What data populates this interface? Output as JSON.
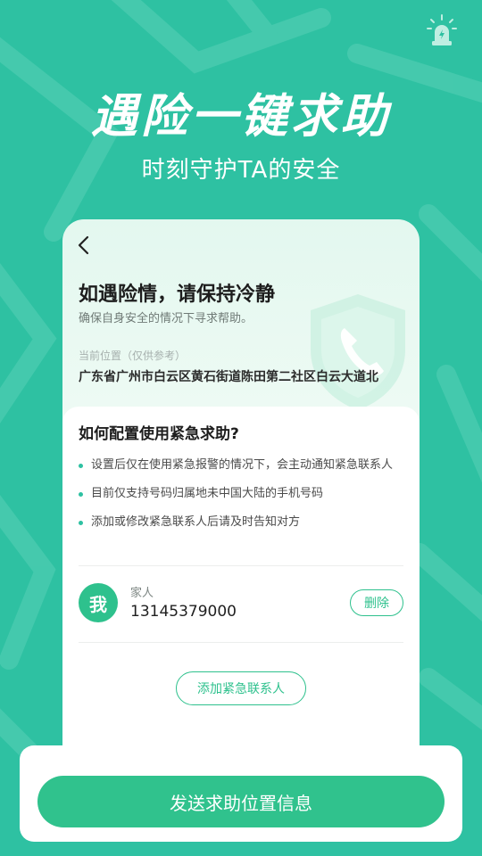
{
  "hero": {
    "title": "遇险一键求助",
    "subtitle": "时刻守护TA的安全"
  },
  "icons": {
    "alarm": "alarm-light-icon",
    "back": "chevron-left-icon",
    "shield": "shield-phone-icon"
  },
  "card": {
    "title": "如遇险情，请保持冷静",
    "subtitle": "确保自身安全的情况下寻求帮助。",
    "location_label": "当前位置（仅供参考）",
    "location_value": "广东省广州市白云区黄石街道陈田第二社区白云大道北"
  },
  "howto": {
    "title": "如何配置使用紧急求助?",
    "tips": [
      "设置后仅在使用紧急报警的情况下，会主动通知紧急联系人",
      "目前仅支持号码归属地未中国大陆的手机号码",
      "添加或修改紧急联系人后请及时告知对方"
    ]
  },
  "contact": {
    "avatar": "我",
    "name": "家人",
    "phone": "13145379000",
    "delete_label": "删除"
  },
  "add_contact_label": "添加紧急联系人",
  "send_label": "发送求助位置信息",
  "colors": {
    "background": "#2ec1a2",
    "accent": "#2ec18d",
    "button": "#30c28d"
  }
}
